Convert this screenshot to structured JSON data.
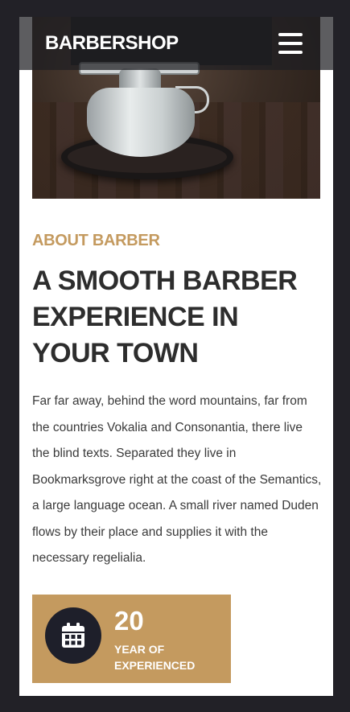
{
  "navbar": {
    "brand": "BARBERSHOP",
    "menu_icon": "hamburger-menu-icon"
  },
  "hero": {
    "image": "barber-chair-photo"
  },
  "about": {
    "eyebrow": "ABOUT BARBER",
    "headline": "A SMOOTH BARBER EXPERIENCE IN YOUR TOWN",
    "body": "Far far away, behind the word mountains, far from the countries Vokalia and Consonantia, there live the blind texts. Separated they live in Bookmarksgrove right at the coast of the Semantics, a large language ocean. A small river named Duden flows by their place and supplies it with the necessary regelialia."
  },
  "stat": {
    "icon": "calendar-icon",
    "number": "20",
    "label": "YEAR OF EXPERIENCED"
  },
  "colors": {
    "accent": "#c49a5f",
    "dark": "#1e1f2a",
    "page_bg": "#222127"
  }
}
